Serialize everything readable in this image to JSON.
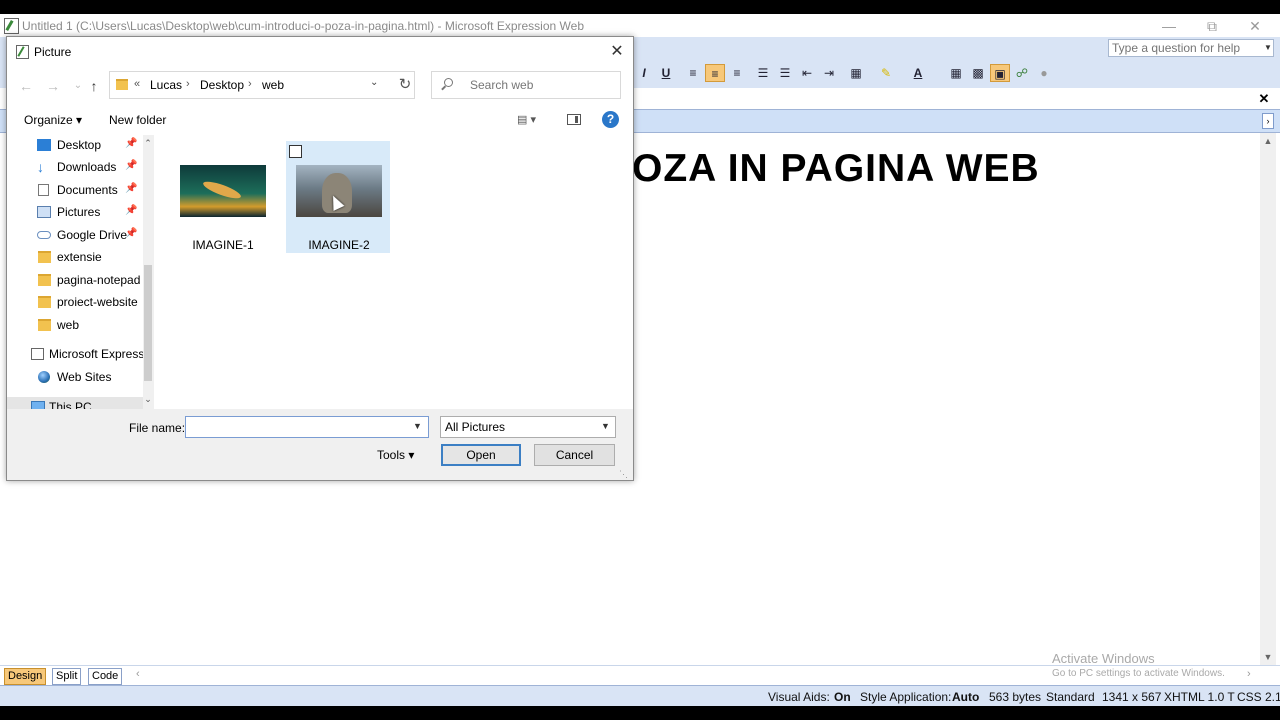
{
  "app": {
    "title": "Untitled 1 (C:\\Users\\Lucas\\Desktop\\web\\cum-introduci-o-poza-in-pagina.html) - Microsoft Expression Web",
    "help_placeholder": "Type a question for help",
    "heading_visible": "OZA IN PAGINA WEB",
    "view_tabs": [
      "Design",
      "Split",
      "Code"
    ],
    "activate": {
      "title": "Activate Windows",
      "subtitle": "Go to PC settings to activate Windows."
    },
    "status": {
      "visual_aids_label": "Visual Aids:",
      "visual_aids_value": "On",
      "style_app_label": "Style Application:",
      "style_app_value": "Auto",
      "size": "563 bytes",
      "mode": "Standard",
      "dims": "1341 x 567",
      "doctype": "XHTML 1.0 T",
      "css": "CSS 2.1"
    }
  },
  "dialog": {
    "title": "Picture",
    "breadcrumb": [
      "Lucas",
      "Desktop",
      "web"
    ],
    "breadcrumb_prefix": "«",
    "search_placeholder": "Search web",
    "organize": "Organize",
    "new_folder": "New folder",
    "sidebar": [
      {
        "label": "Desktop",
        "icon": "desktop-icon",
        "pinned": true
      },
      {
        "label": "Downloads",
        "icon": "download-icon",
        "pinned": true
      },
      {
        "label": "Documents",
        "icon": "documents-icon",
        "pinned": true
      },
      {
        "label": "Pictures",
        "icon": "pictures-icon",
        "pinned": true
      },
      {
        "label": "Google Drive",
        "icon": "cloud-icon",
        "pinned": true
      },
      {
        "label": "extensie",
        "icon": "folder-icon",
        "pinned": false
      },
      {
        "label": "pagina-notepad",
        "icon": "folder-icon",
        "pinned": false
      },
      {
        "label": "proiect-website",
        "icon": "folder-icon",
        "pinned": false
      },
      {
        "label": "web",
        "icon": "folder-icon",
        "pinned": false
      },
      {
        "label": "Microsoft Express",
        "icon": "expression-web-icon",
        "pinned": false
      },
      {
        "label": "Web Sites",
        "icon": "globe-icon",
        "pinned": false
      },
      {
        "label": "This PC",
        "icon": "pc-icon",
        "pinned": false
      }
    ],
    "files": [
      {
        "name": "IMAGINE-1",
        "selected": false
      },
      {
        "name": "IMAGINE-2",
        "selected": true
      }
    ],
    "file_name_label": "File name:",
    "file_name_value": "",
    "filter": "All Pictures",
    "tools": "Tools",
    "open": "Open",
    "cancel": "Cancel"
  }
}
